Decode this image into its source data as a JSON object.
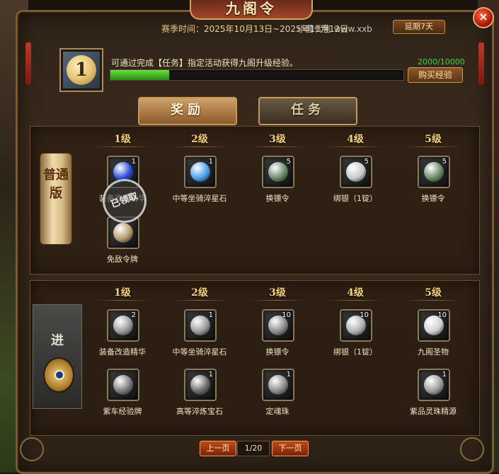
{
  "window": {
    "title": "九阁令",
    "close_icon": "×"
  },
  "season": {
    "label": "赛季时间：",
    "dates": "2025年10月13日~2025年11月12日",
    "overlay_text": "小曹代售 www.xxb",
    "button": "延期7天"
  },
  "level_badge": {
    "value": "1"
  },
  "task": {
    "description": "可通过完成【任务】指定活动获得九阁升级经验。",
    "exp_text": "2000/10000",
    "exp_progress": 0.2,
    "buy_button": "购买经验"
  },
  "tabs": [
    {
      "label": "奖励",
      "active": true
    },
    {
      "label": "任务",
      "active": false
    }
  ],
  "tiers": [
    {
      "label": "普通版",
      "levels": [
        "1级",
        "2级",
        "3级",
        "4级",
        "5级"
      ],
      "claimed_label": "已领取",
      "items": [
        {
          "name": "装备改造精华",
          "count": "1",
          "color": "#2a4ad8"
        },
        {
          "name": "中等坐骑淬星石",
          "count": "1",
          "color": "#4aa0e8"
        },
        {
          "name": "换镖令",
          "count": "5",
          "color": "#6a8a6a"
        },
        {
          "name": "绑银（1锭）",
          "count": "5",
          "color": "#c8c8c8"
        },
        {
          "name": "换镖令",
          "count": "5",
          "color": "#6a8a6a"
        },
        {
          "name": "免敌令牌",
          "count": "",
          "color": "#b89a6a"
        }
      ]
    },
    {
      "label": "进",
      "levels": [
        "1级",
        "2级",
        "3级",
        "4级",
        "5级"
      ],
      "items": [
        {
          "name": "装备改造精华",
          "count": "2",
          "color": "#9a9a9a"
        },
        {
          "name": "中等坐骑淬星石",
          "count": "1",
          "color": "#9a9a9a"
        },
        {
          "name": "换镖令",
          "count": "10",
          "color": "#8a8a8a"
        },
        {
          "name": "绑银（1锭）",
          "count": "10",
          "color": "#b0b0b0"
        },
        {
          "name": "九阁圣物",
          "count": "10",
          "color": "#d0d0d0"
        },
        {
          "name": "紫车经验牌",
          "count": "",
          "color": "#7a7a7a"
        },
        {
          "name": "高等淬炼宝石",
          "count": "1",
          "color": "#6a6a6a"
        },
        {
          "name": "定魂珠",
          "count": "1",
          "color": "#8a8a8a"
        },
        {
          "name": "紫品灵珠精源",
          "count": "1",
          "color": "#9a9a9a"
        }
      ]
    }
  ],
  "pager": {
    "prev": "上一页",
    "page": "1/20",
    "next": "下一页"
  }
}
